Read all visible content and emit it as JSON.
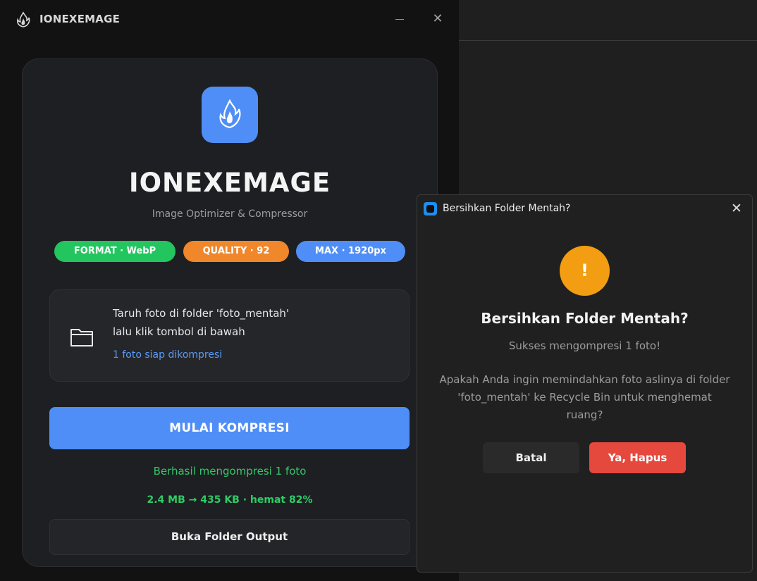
{
  "window": {
    "title": "IONEXEMAGE",
    "logo_icon": "flame-logo-icon",
    "minimize_icon": "minimize-icon",
    "close_symbol": "✕"
  },
  "app": {
    "name": "IONEXEMAGE",
    "subtitle": "Image Optimizer & Compressor",
    "accent_color": "#4f8ef7"
  },
  "badges": [
    {
      "label": "FORMAT · WebP",
      "color": "#22c55e"
    },
    {
      "label": "QUALITY · 92",
      "color": "#f0872b"
    },
    {
      "label": "MAX · 1920px",
      "color": "#4f8ef7"
    }
  ],
  "dropzone": {
    "icon": "folder-icon",
    "line1": "Taruh foto di folder 'foto_mentah'",
    "line2": "lalu klik tombol di bawah",
    "status": "1 foto siap dikompresi"
  },
  "actions": {
    "start_label": "MULAI KOMPRESI",
    "result": "Berhasil mengompresi 1 foto",
    "savings": "2.4 MB → 435 KB  ·  hemat 82%",
    "open_folder_label": "Buka Folder Output"
  },
  "dialog": {
    "title": "Bersihkan Folder Mentah?",
    "close_symbol": "✕",
    "warning_icon": "exclamation-icon",
    "warning_symbol": "!",
    "heading": "Bersihkan Folder Mentah?",
    "subheading": "Sukses mengompresi 1 foto!",
    "body": "Apakah Anda ingin memindahkan foto aslinya di folder 'foto_mentah' ke Recycle Bin untuk menghemat ruang?",
    "cancel_label": "Batal",
    "confirm_label": "Ya, Hapus",
    "confirm_color": "#e5483d",
    "warning_color": "#f29d12"
  }
}
